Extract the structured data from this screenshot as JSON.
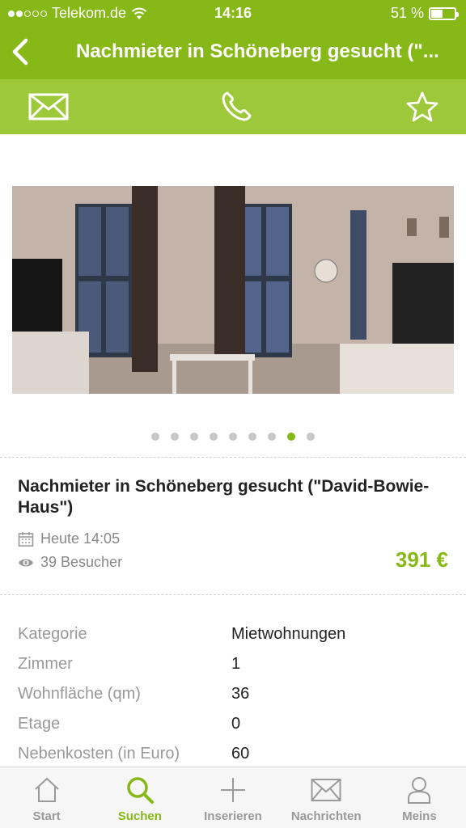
{
  "status_bar": {
    "carrier": "Telekom.de",
    "time": "14:16",
    "battery": "51 %",
    "battery_level": 0.51
  },
  "nav": {
    "title": "Nachmieter in Schöneberg gesucht (\"..."
  },
  "actions": {
    "icons": [
      "mail-icon",
      "phone-icon",
      "star-icon"
    ]
  },
  "gallery": {
    "count": 9,
    "active_index": 7
  },
  "listing": {
    "title": "Nachmieter in Schöneberg gesucht (\"David-Bowie-Haus\")",
    "date": "Heute 14:05",
    "visitors": "39 Besucher",
    "price": "391 €"
  },
  "details": [
    {
      "key": "Kategorie",
      "value": "Mietwohnungen"
    },
    {
      "key": "Zimmer",
      "value": "1"
    },
    {
      "key": "Wohnfläche (qm)",
      "value": "36"
    },
    {
      "key": "Etage",
      "value": "0"
    },
    {
      "key": "Nebenkosten (in Euro)",
      "value": "60"
    }
  ],
  "tabs": [
    {
      "label": "Start",
      "icon": "home-icon"
    },
    {
      "label": "Suchen",
      "icon": "search-icon",
      "active": true
    },
    {
      "label": "Inserieren",
      "icon": "plus-icon"
    },
    {
      "label": "Nachrichten",
      "icon": "envelope-icon"
    },
    {
      "label": "Meins",
      "icon": "user-icon"
    }
  ],
  "colors": {
    "brand": "#86b817",
    "action_bar": "#9cc83a"
  }
}
